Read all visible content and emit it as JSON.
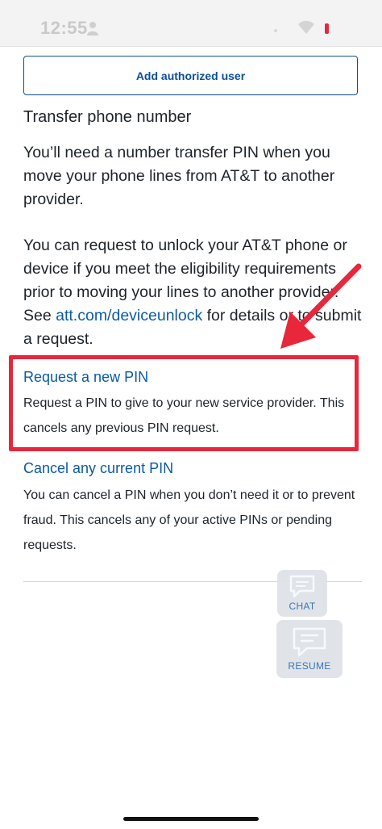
{
  "status_bar": {
    "time": "12:55"
  },
  "actions": {
    "add_user_label": "Add authorized user"
  },
  "transfer": {
    "title": "Transfer phone number",
    "paragraph1": "You’ll need a number transfer PIN when you move your phone lines from AT&T to another provider.",
    "paragraph2_before": "You can request to unlock your AT&T phone or device if you meet the eligibility requirements prior to moving your lines to another provider. See ",
    "paragraph2_link": "att.com/deviceunlock",
    "paragraph2_after": " for details or to submit a request."
  },
  "request_pin": {
    "link": "Request a new PIN",
    "description": "Request a PIN to give to your new service provider. This cancels any previous PIN request."
  },
  "cancel_pin": {
    "link": "Cancel any current PIN",
    "description": "You can cancel a PIN when you don’t need it or to prevent fraud. This cancels any of your active PINs or pending requests."
  },
  "floating": {
    "chat_label": "CHAT",
    "resume_label": "RESUME"
  },
  "colors": {
    "link_blue": "#0b5aa6",
    "button_border": "#0b4f97",
    "annotation_red": "#e8273b"
  }
}
